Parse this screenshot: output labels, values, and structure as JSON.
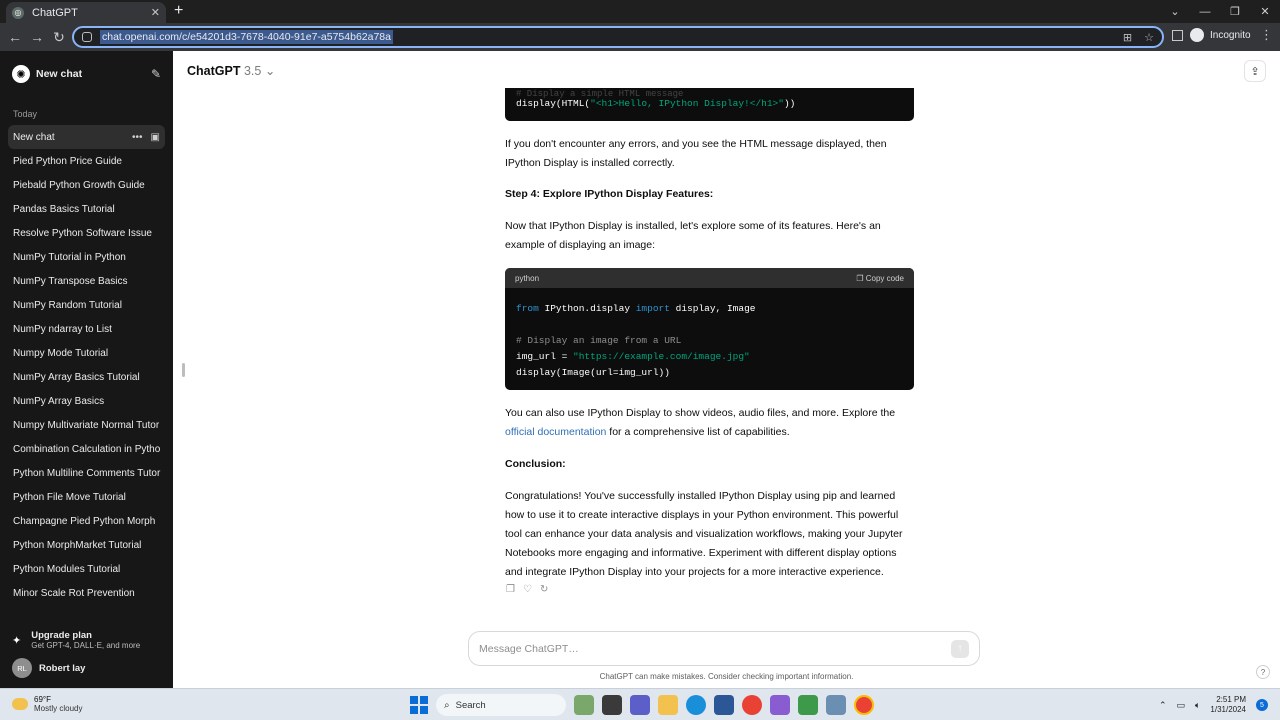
{
  "browser": {
    "tab_title": "ChatGPT",
    "tab_close": "✕",
    "new_tab": "+",
    "url": "chat.openai.com/c/e54201d3-7678-4040-91e7-a5754b62a78a",
    "incognito_label": "Incognito"
  },
  "sidebar": {
    "new_chat": "New chat",
    "section_today": "Today",
    "active_chat": "New chat",
    "chats": [
      "Pied Python Price Guide",
      "Piebald Python Growth Guide",
      "Pandas Basics Tutorial",
      "Resolve Python Software Issue",
      "NumPy Tutorial in Python",
      "NumPy Transpose Basics",
      "NumPy Random Tutorial",
      "NumPy ndarray to List",
      "Numpy Mode Tutorial",
      "NumPy Array Basics Tutorial",
      "NumPy Array Basics",
      "Numpy Multivariate Normal Tutor",
      "Combination Calculation in Pytho",
      "Python Multiline Comments Tutor",
      "Python File Move Tutorial",
      "Champagne Pied Python Morph",
      "Python MorphMarket Tutorial",
      "Python Modules Tutorial",
      "Minor Scale Rot Prevention"
    ],
    "upgrade_title": "Upgrade plan",
    "upgrade_sub": "Get GPT-4, DALL·E, and more",
    "user_initials": "RL",
    "user_name": "Robert lay"
  },
  "header": {
    "model": "ChatGPT",
    "version": "3.5"
  },
  "conversation": {
    "code1_faded": "# Display a simple HTML message",
    "code1_fn": "display(HTML(",
    "code1_str": "\"<h1>Hello, IPython Display!</h1>\"",
    "code1_end": "))",
    "para1": "If you don't encounter any errors, and you see the HTML message displayed, then IPython Display is installed correctly.",
    "step4": "Step 4: Explore IPython Display Features:",
    "para2": "Now that IPython Display is installed, let's explore some of its features. Here's an example of displaying an image:",
    "code2_lang": "python",
    "code2_copy": "Copy code",
    "code2_from": "from",
    "code2_mod": " IPython.display ",
    "code2_import": "import",
    "code2_names": " display, Image",
    "code2_comment": "# Display an image from a URL",
    "code2_var": "img_url = ",
    "code2_url": "\"https://example.com/image.jpg\"",
    "code2_call": "display(Image(url=img_url))",
    "para3_a": "You can also use IPython Display to show videos, audio files, and more. Explore the ",
    "para3_link": "official documentation",
    "para3_b": " for a comprehensive list of capabilities.",
    "conclusion": "Conclusion:",
    "para4": "Congratulations! You've successfully installed IPython Display using pip and learned how to use it to create interactive displays in your Python environment. This powerful tool can enhance your data analysis and visualization workflows, making your Jupyter Notebooks more engaging and informative. Experiment with different display options and integrate IPython Display into your projects for a more interactive experience."
  },
  "composer": {
    "placeholder": "Message ChatGPT…",
    "disclaimer": "ChatGPT can make mistakes. Consider checking important information.",
    "help": "?"
  },
  "taskbar": {
    "temp": "69°F",
    "weather": "Mostly cloudy",
    "search": "Search",
    "time": "2:51 PM",
    "date": "1/31/2024",
    "notifications": "5"
  },
  "colors": {
    "sidebar_bg": "#171717",
    "link": "#2f6fb4",
    "code_bg": "#0d0d0d",
    "keyword": "#2e95d3",
    "string": "#00a67d"
  }
}
